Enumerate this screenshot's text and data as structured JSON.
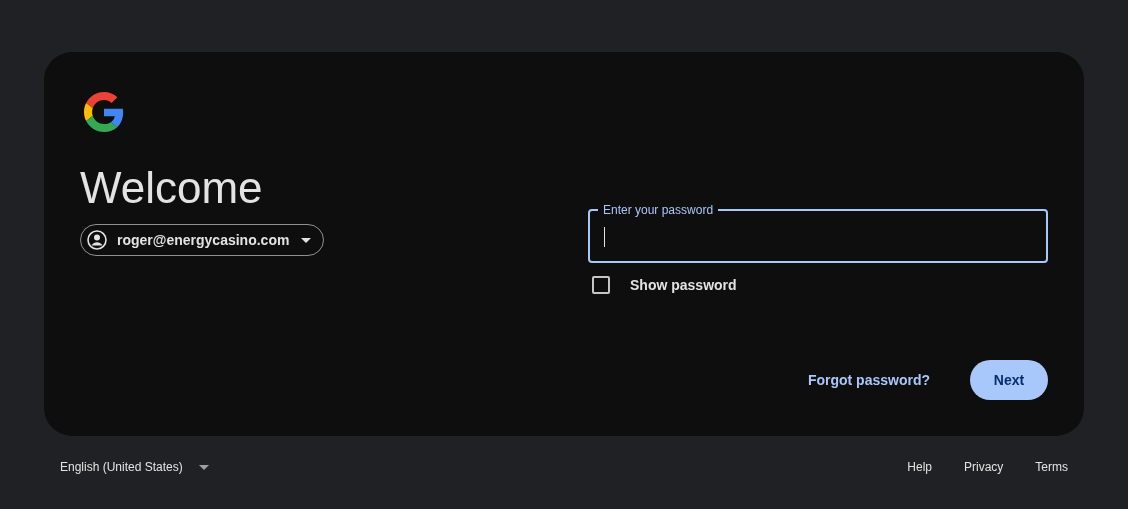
{
  "heading": "Welcome",
  "account": {
    "email": "roger@energycasino.com"
  },
  "password_field": {
    "label": "Enter your password",
    "focused": true
  },
  "show_password": {
    "label": "Show password",
    "checked": false
  },
  "actions": {
    "link": "Forgot password?",
    "button": "Next"
  },
  "footer": {
    "language": "English (United States)",
    "links": [
      "Help",
      "Privacy",
      "Terms"
    ]
  }
}
